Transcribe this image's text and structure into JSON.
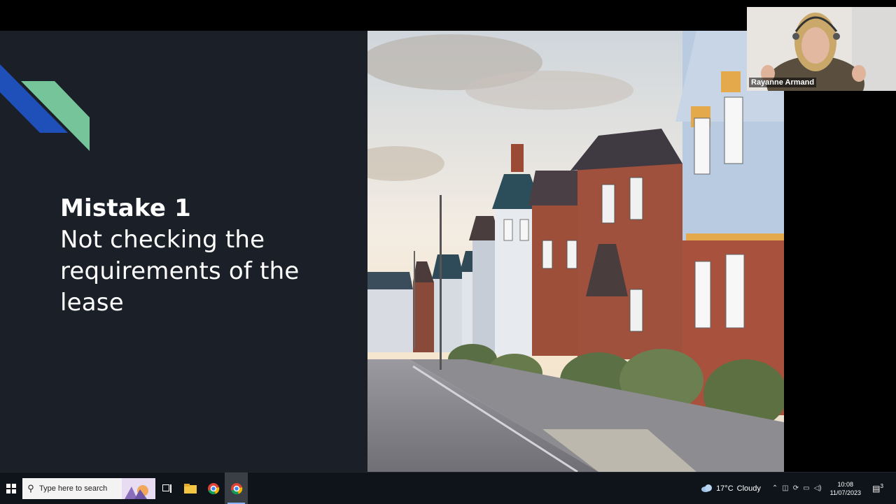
{
  "slide": {
    "heading_bold": "Mistake 1",
    "heading_line1": "Not checking the",
    "heading_line2": "requirements of the",
    "heading_line3": "lease",
    "accent_colors": {
      "blue": "#1f4fb8",
      "green": "#76c49a"
    },
    "background": "#1a1f28"
  },
  "video": {
    "participant_name": "Rayanne Armand"
  },
  "taskbar": {
    "search_placeholder": "Type here to search",
    "weather_temp": "17°C",
    "weather_desc": "Cloudy",
    "time": "10:08",
    "date": "11/07/2023",
    "notification_count": "3",
    "apps": [
      "windows-start",
      "task-view",
      "file-explorer",
      "chrome",
      "chrome-active"
    ]
  }
}
